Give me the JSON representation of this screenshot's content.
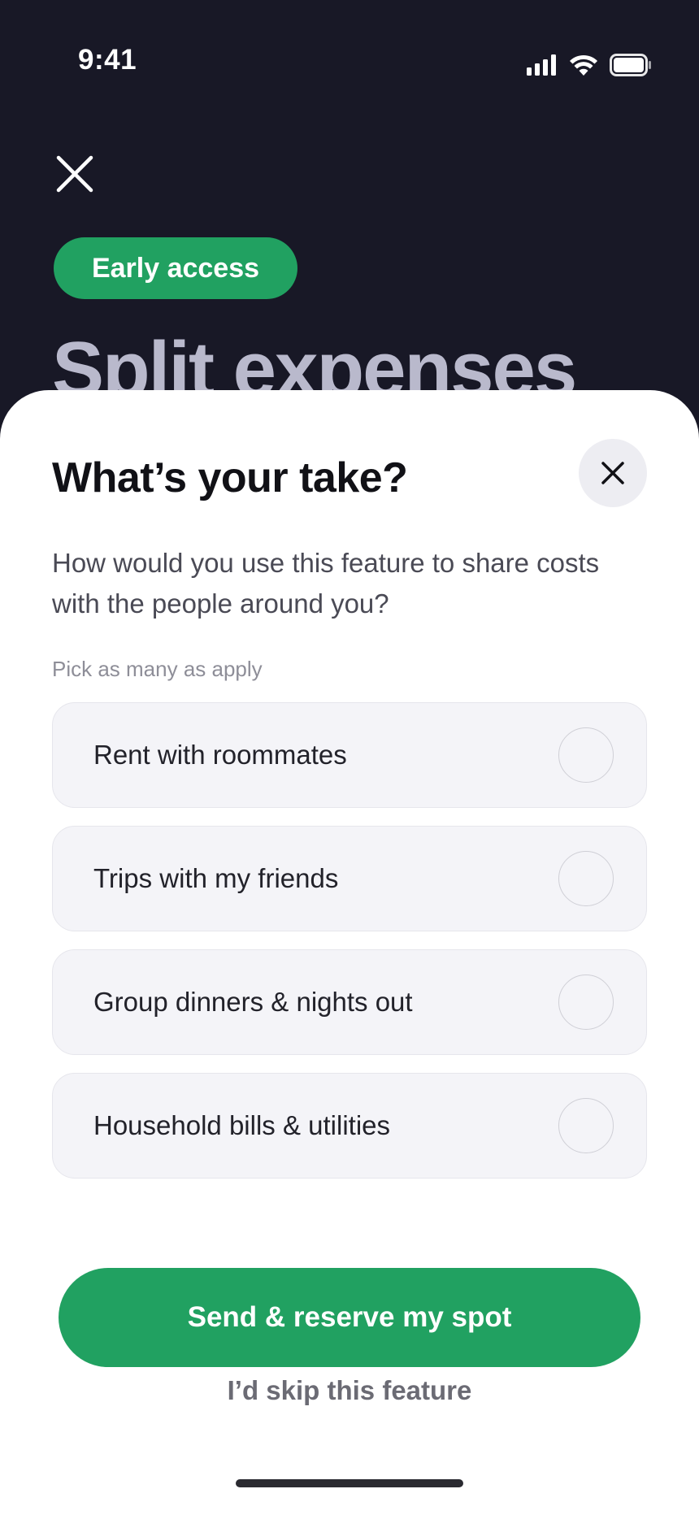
{
  "status_bar": {
    "time": "9:41",
    "icons": [
      "cellular-signal-icon",
      "wifi-icon",
      "battery-icon"
    ]
  },
  "background_page": {
    "close_icon": "close-icon",
    "badge": "Early access",
    "title": "Split expenses"
  },
  "sheet": {
    "title": "What’s your take?",
    "close_icon": "close-icon",
    "description": "How would you use this feature to share costs with the people around you?",
    "hint": "Pick as many as apply",
    "options": [
      {
        "label": "Rent with roommates",
        "selected": false
      },
      {
        "label": "Trips with my friends",
        "selected": false
      },
      {
        "label": "Group dinners & nights out",
        "selected": false
      },
      {
        "label": "Household bills & utilities",
        "selected": false
      }
    ],
    "primary_button": "Send & reserve my spot",
    "skip_link": "I’d skip this feature"
  },
  "colors": {
    "background_dark": "#181826",
    "accent_green": "#21a161",
    "sheet_bg": "#ffffff",
    "option_bg": "#f4f4f8"
  }
}
